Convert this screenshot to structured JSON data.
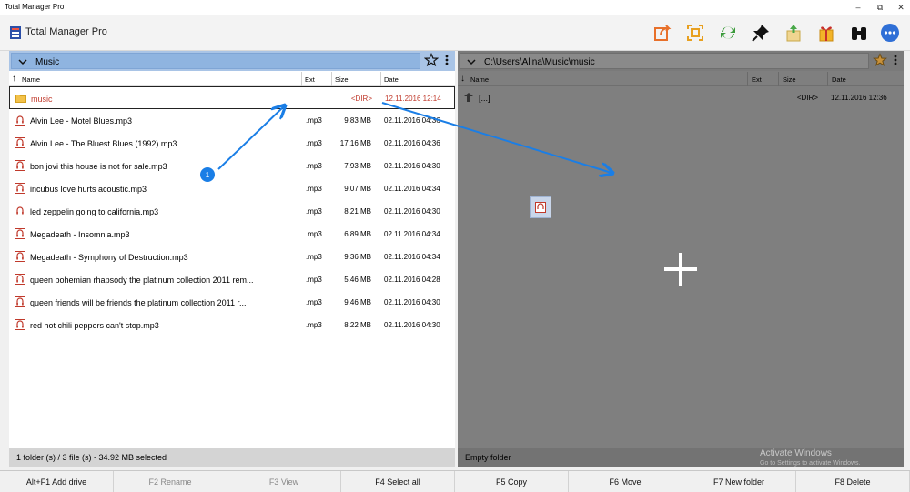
{
  "window": {
    "title": "Total Manager Pro"
  },
  "app": {
    "name": "Total Manager Pro"
  },
  "colors": {
    "accent": "#1a7ee6",
    "left_header": "#a9c4e6",
    "right_panel": "#7f7f7f",
    "selected_text": "#c0392b"
  },
  "toolbar": {
    "icons": [
      "share-icon",
      "select-frame-icon",
      "refresh-icon",
      "pin-icon",
      "upload-icon",
      "package-icon",
      "binoculars-icon",
      "more-icon"
    ]
  },
  "left_panel": {
    "title": "Music",
    "columns": {
      "name": "Name",
      "ext": "Ext",
      "size": "Size",
      "date": "Date"
    },
    "rows": [
      {
        "name": "music",
        "ext": "",
        "size": "<DIR>",
        "date": "12.11.2016 12:14",
        "type": "folder"
      },
      {
        "name": "Alvin Lee - Motel Blues.mp3",
        "ext": ".mp3",
        "size": "9.83 MB",
        "date": "02.11.2016 04:36",
        "type": "audio"
      },
      {
        "name": "Alvin Lee - The Bluest Blues (1992).mp3",
        "ext": ".mp3",
        "size": "17.16 MB",
        "date": "02.11.2016 04:36",
        "type": "audio"
      },
      {
        "name": "bon jovi this house is not for sale.mp3",
        "ext": ".mp3",
        "size": "7.93 MB",
        "date": "02.11.2016 04:30",
        "type": "audio"
      },
      {
        "name": "incubus love hurts acoustic.mp3",
        "ext": ".mp3",
        "size": "9.07 MB",
        "date": "02.11.2016 04:34",
        "type": "audio"
      },
      {
        "name": "led zeppelin going to california.mp3",
        "ext": ".mp3",
        "size": "8.21 MB",
        "date": "02.11.2016 04:30",
        "type": "audio"
      },
      {
        "name": "Megadeath - Insomnia.mp3",
        "ext": ".mp3",
        "size": "6.89 MB",
        "date": "02.11.2016 04:34",
        "type": "audio"
      },
      {
        "name": "Megadeath - Symphony of Destruction.mp3",
        "ext": ".mp3",
        "size": "9.36 MB",
        "date": "02.11.2016 04:34",
        "type": "audio"
      },
      {
        "name": "queen bohemian rhapsody the platinum collection 2011 rem...",
        "ext": ".mp3",
        "size": "5.46 MB",
        "date": "02.11.2016 04:28",
        "type": "audio"
      },
      {
        "name": "queen friends will be friends the platinum collection 2011 r...",
        "ext": ".mp3",
        "size": "9.46 MB",
        "date": "02.11.2016 04:30",
        "type": "audio"
      },
      {
        "name": "red hot chili peppers can't stop.mp3",
        "ext": ".mp3",
        "size": "8.22 MB",
        "date": "02.11.2016 04:30",
        "type": "audio"
      }
    ],
    "status": "1 folder (s) / 3 file (s) - 34.92 MB selected"
  },
  "right_panel": {
    "title": "C:\\Users\\Alina\\Music\\music",
    "columns": {
      "name": "Name",
      "ext": "Ext",
      "size": "Size",
      "date": "Date"
    },
    "rows": [
      {
        "name": "[...]",
        "ext": "",
        "size": "<DIR>",
        "date": "12.11.2016 12:36"
      }
    ],
    "status": "Empty folder",
    "drop_icon": "plus-icon"
  },
  "annotation": {
    "step_badge": "1"
  },
  "watermark": {
    "line1": "Activate Windows",
    "line2": "Go to Settings to activate Windows."
  },
  "function_keys": [
    {
      "label": "Alt+F1  Add drive",
      "enabled": true
    },
    {
      "label": "F2  Rename",
      "enabled": false
    },
    {
      "label": "F3  View",
      "enabled": false
    },
    {
      "label": "F4  Select all",
      "enabled": true
    },
    {
      "label": "F5  Copy",
      "enabled": true
    },
    {
      "label": "F6  Move",
      "enabled": true
    },
    {
      "label": "F7  New folder",
      "enabled": true
    },
    {
      "label": "F8  Delete",
      "enabled": true
    }
  ]
}
